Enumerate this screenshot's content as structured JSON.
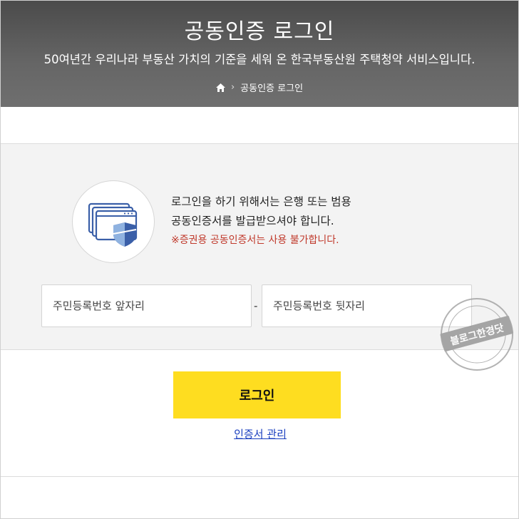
{
  "header": {
    "title": "공동인증 로그인",
    "subtitle": "50여년간 우리나라 부동산 가치의 기준을 세워 온 한국부동산원 주택청약 서비스입니다.",
    "breadcrumb": {
      "current": "공동인증 로그인"
    }
  },
  "panel": {
    "message_line1": "로그인을 하기 위해서는 은행 또는 범용",
    "message_line2": "공동인증서를 발급받으셔야 합니다.",
    "warning": "※증권용 공동인증서는 사용 불가합니다.",
    "id_front_placeholder": "주민등록번호 앞자리",
    "id_back_placeholder": "주민등록번호 뒷자리",
    "separator": "-"
  },
  "actions": {
    "login_label": "로그인",
    "cert_manage_label": "인증서 관리"
  },
  "watermark": {
    "text": "블로그한경닷"
  },
  "colors": {
    "accent": "#fedd20",
    "warning": "#c0392b",
    "link": "#1a3fbf"
  },
  "icons": [
    "home-icon",
    "chevron-right-icon",
    "certificate-shield-icon"
  ]
}
